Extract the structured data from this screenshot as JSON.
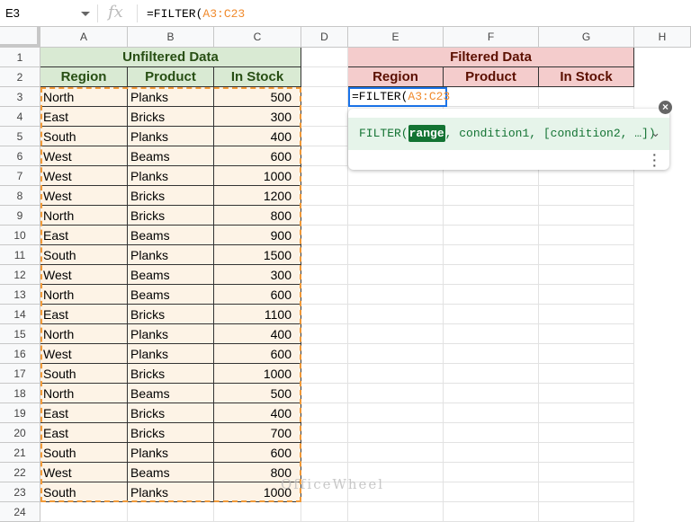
{
  "formula_bar": {
    "name_box": "E3",
    "fx_label": "fx",
    "formula_prefix": "=FILTER(",
    "formula_ref": "A3:C23"
  },
  "columns": [
    "A",
    "B",
    "C",
    "D",
    "E",
    "F",
    "G",
    "H"
  ],
  "rows": [
    "1",
    "2",
    "3",
    "4",
    "5",
    "6",
    "7",
    "8",
    "9",
    "10",
    "11",
    "12",
    "13",
    "14",
    "15",
    "16",
    "17",
    "18",
    "19",
    "20",
    "21",
    "22",
    "23",
    "24"
  ],
  "unfiltered": {
    "title": "Unfiltered Data",
    "headers": [
      "Region",
      "Product",
      "In Stock"
    ],
    "data": [
      [
        "North",
        "Planks",
        "500"
      ],
      [
        "East",
        "Bricks",
        "300"
      ],
      [
        "South",
        "Planks",
        "400"
      ],
      [
        "West",
        "Beams",
        "600"
      ],
      [
        "West",
        "Planks",
        "1000"
      ],
      [
        "West",
        "Bricks",
        "1200"
      ],
      [
        "North",
        "Bricks",
        "800"
      ],
      [
        "East",
        "Beams",
        "900"
      ],
      [
        "South",
        "Planks",
        "1500"
      ],
      [
        "West",
        "Beams",
        "300"
      ],
      [
        "North",
        "Beams",
        "600"
      ],
      [
        "East",
        "Bricks",
        "1100"
      ],
      [
        "North",
        "Planks",
        "400"
      ],
      [
        "West",
        "Planks",
        "600"
      ],
      [
        "South",
        "Bricks",
        "1000"
      ],
      [
        "North",
        "Beams",
        "500"
      ],
      [
        "East",
        "Bricks",
        "400"
      ],
      [
        "East",
        "Bricks",
        "700"
      ],
      [
        "South",
        "Planks",
        "600"
      ],
      [
        "West",
        "Beams",
        "800"
      ],
      [
        "South",
        "Planks",
        "1000"
      ]
    ]
  },
  "filtered": {
    "title": "Filtered Data",
    "headers": [
      "Region",
      "Product",
      "In Stock"
    ]
  },
  "editor": {
    "prefix": "=FILTER(",
    "ref": "A3:C23"
  },
  "hint": {
    "fn": "FILTER(",
    "arg": "range",
    "rest": ", condition1, [condition2, …])"
  },
  "watermark": "OfficeWheel"
}
